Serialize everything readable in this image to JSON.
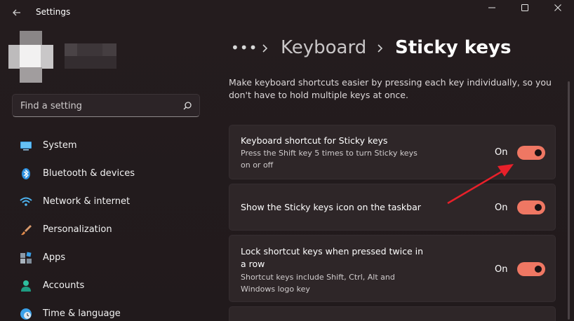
{
  "window": {
    "title": "Settings",
    "controls": {
      "minimize": "minimize-icon",
      "maximize": "maximize-icon",
      "close": "close-icon"
    }
  },
  "search": {
    "placeholder": "Find a setting"
  },
  "sidebar": {
    "items": [
      {
        "label": "System",
        "icon": "monitor-icon"
      },
      {
        "label": "Bluetooth & devices",
        "icon": "bluetooth-icon"
      },
      {
        "label": "Network & internet",
        "icon": "wifi-icon"
      },
      {
        "label": "Personalization",
        "icon": "brush-icon"
      },
      {
        "label": "Apps",
        "icon": "apps-icon"
      },
      {
        "label": "Accounts",
        "icon": "person-icon"
      },
      {
        "label": "Time & language",
        "icon": "globe-clock-icon"
      }
    ]
  },
  "breadcrumb": {
    "overflow": "•••",
    "parent": "Keyboard",
    "current": "Sticky keys"
  },
  "main": {
    "description": "Make keyboard shortcuts easier by pressing each key individually, so you don't have to hold multiple keys at once.",
    "settings": [
      {
        "title": "Keyboard shortcut for Sticky keys",
        "description": "Press the Shift key 5 times to turn Sticky keys on or off",
        "state": "On",
        "enabled": true
      },
      {
        "title": "Show the Sticky keys icon on the taskbar",
        "description": "",
        "state": "On",
        "enabled": true
      },
      {
        "title": "Lock shortcut keys when pressed twice in a row",
        "description": "Shortcut keys include Shift, Ctrl, Alt and Windows logo key",
        "state": "On",
        "enabled": true
      }
    ]
  },
  "colors": {
    "accent": "#ef7763",
    "annotation_arrow": "#e8202a",
    "background": "#231b1d"
  }
}
